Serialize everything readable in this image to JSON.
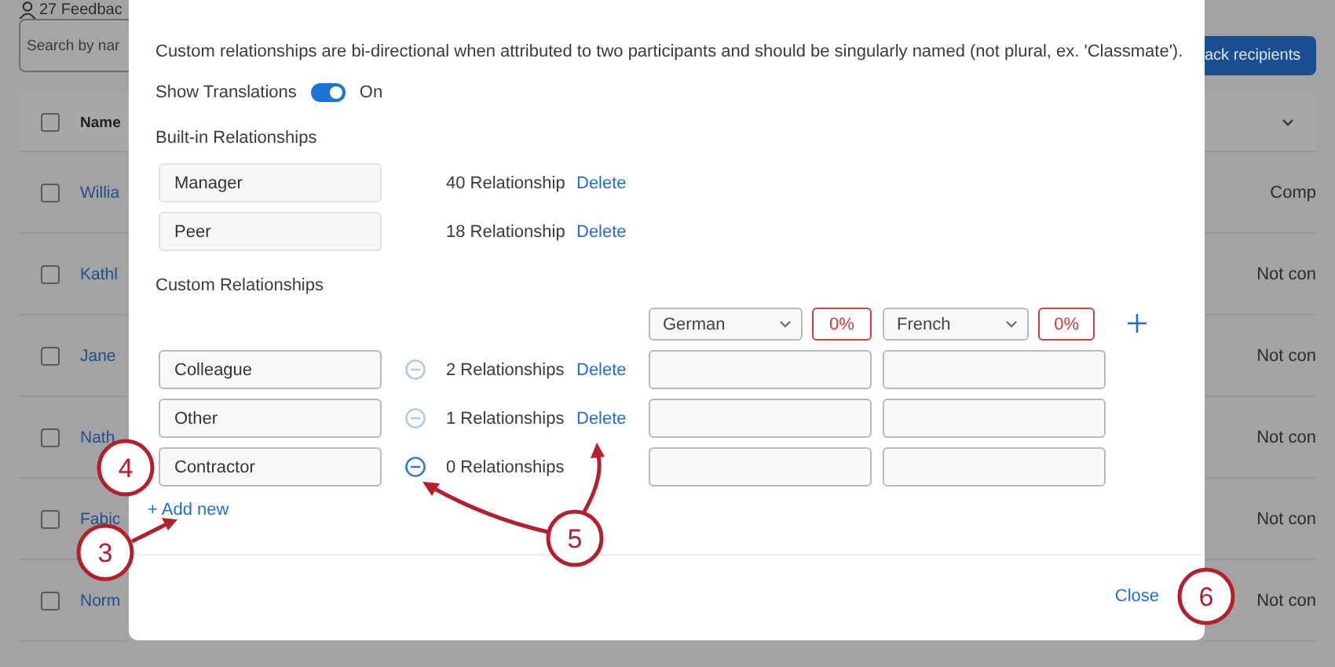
{
  "background": {
    "header_text": "27 Feedbac",
    "search": {
      "placeholder": "Search by nar"
    },
    "button": "ack recipients",
    "name_column": "Name",
    "select_all": {
      "checked": false
    },
    "rows": [
      {
        "name": "Willia",
        "status": "Comp",
        "checked": false
      },
      {
        "name": "Kathl",
        "status": "Not con",
        "checked": false
      },
      {
        "name": "Jane",
        "status": "Not con",
        "checked": false
      },
      {
        "name": "Nath",
        "status": "Not con",
        "checked": false
      },
      {
        "name": "Fabic",
        "status": "Not con",
        "checked": false
      },
      {
        "name": "Norm",
        "status": "Not con",
        "checked": false
      }
    ]
  },
  "modal": {
    "description": "Custom relationships are bi-directional when attributed to two participants and should be singularly named (not plural, ex. 'Classmate').",
    "show_translations": {
      "label": "Show Translations",
      "on": true,
      "state_text": "On"
    },
    "builtin_title": "Built-in Relationships",
    "builtin": [
      {
        "name": "Manager",
        "count": "40 Relationship",
        "action": "Delete"
      },
      {
        "name": "Peer",
        "count": "18 Relationship",
        "action": "Delete"
      }
    ],
    "custom_title": "Custom Relationships",
    "languages": [
      {
        "name": "German",
        "completion": "0%"
      },
      {
        "name": "French",
        "completion": "0%"
      }
    ],
    "custom": [
      {
        "name": "Colleague",
        "count": "2 Relationships",
        "action": "Delete",
        "remove_disabled": true
      },
      {
        "name": "Other",
        "count": "1 Relationships",
        "action": "Delete",
        "remove_disabled": true
      },
      {
        "name": "Contractor",
        "count": "0 Relationships",
        "remove_disabled": false
      }
    ],
    "add_new": "+ Add new",
    "close": "Close"
  },
  "annotations": [
    {
      "label": "3"
    },
    {
      "label": "4"
    },
    {
      "label": "5"
    },
    {
      "label": "6"
    }
  ]
}
